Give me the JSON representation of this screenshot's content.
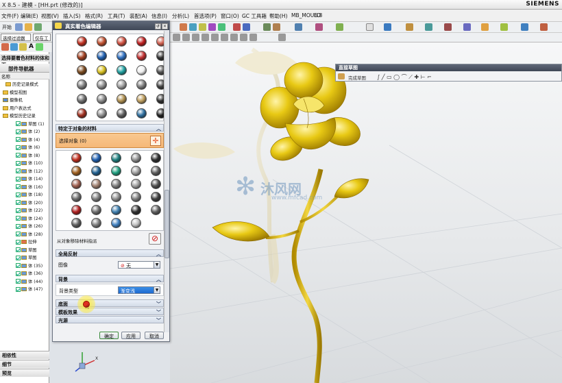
{
  "titlebar": {
    "title": "X 8.5 - 建模 - [HH.prt (修改的)]",
    "brand": "SIEMENS"
  },
  "menu": [
    "文件(F)",
    "编辑(E)",
    "视图(V)",
    "插入(S)",
    "格式(R)",
    "工具(T)",
    "装配(A)",
    "信息(I)",
    "分析(L)",
    "首选项(P)",
    "窗口(O)",
    "GC 工具箱",
    "帮助(H)",
    "MB_MOULD",
    "B.8"
  ],
  "toolbar": {
    "filter_label": "选择过滤器",
    "scope_label": "仅在工",
    "start_label": "开始"
  },
  "nav": {
    "panel_title": "选择要着色材料的体和面",
    "title": "部件导航器",
    "col_name": "名称",
    "items": [
      {
        "label": "历史记录模式",
        "kind": "mode"
      },
      {
        "label": "模型视图",
        "kind": "folder"
      },
      {
        "label": "摄像机",
        "kind": "camera"
      },
      {
        "label": "用户表达式",
        "kind": "folder"
      },
      {
        "label": "模型历史记录",
        "kind": "folder"
      },
      {
        "label": "草图 (1)",
        "kind": "feat"
      },
      {
        "label": "体 (2)",
        "kind": "feat"
      },
      {
        "label": "体 (4)",
        "kind": "feat"
      },
      {
        "label": "体 (6)",
        "kind": "feat"
      },
      {
        "label": "体 (8)",
        "kind": "feat"
      },
      {
        "label": "体 (10)",
        "kind": "feat"
      },
      {
        "label": "体 (12)",
        "kind": "feat"
      },
      {
        "label": "体 (14)",
        "kind": "feat"
      },
      {
        "label": "体 (16)",
        "kind": "feat"
      },
      {
        "label": "体 (18)",
        "kind": "feat"
      },
      {
        "label": "体 (20)",
        "kind": "feat"
      },
      {
        "label": "体 (22)",
        "kind": "feat"
      },
      {
        "label": "体 (24)",
        "kind": "feat"
      },
      {
        "label": "体 (26)",
        "kind": "feat"
      },
      {
        "label": "体 (28)",
        "kind": "feat"
      },
      {
        "label": "拉伸",
        "kind": "feat-x"
      },
      {
        "label": "草图",
        "kind": "feat"
      },
      {
        "label": "草图",
        "kind": "feat"
      },
      {
        "label": "体 (35)",
        "kind": "feat"
      },
      {
        "label": "体 (36)",
        "kind": "feat"
      },
      {
        "label": "体 (44)",
        "kind": "feat"
      },
      {
        "label": "体 (47)",
        "kind": "feat"
      }
    ],
    "bottom": [
      "相依性",
      "细节",
      "预览"
    ]
  },
  "dialog": {
    "title": "真实着色编辑器",
    "sect_specific": "特定于对象的材料",
    "select_object": "选择对象 (0)",
    "remove_label": "从对象移除材料指派",
    "sect_global": "全局反射",
    "image_label": "图像",
    "image_value": "无",
    "sect_background": "背景",
    "bg_type_label": "背景类型",
    "bg_type_value": "渐变浅",
    "sect_floor": "底面",
    "sect_light": "光源",
    "sect_model": "模板效果",
    "ok": "确定",
    "apply": "应用",
    "cancel": "取消"
  },
  "sketch_toolbar": {
    "title": "直接草图",
    "finish": "完成草图"
  },
  "watermark": {
    "brand": "沐风网",
    "url": "www.mfcad.com"
  },
  "colors": {
    "accent_titlebar": "#4a5262",
    "gold": "#e6c416",
    "selected_row": "#ffd27a"
  }
}
